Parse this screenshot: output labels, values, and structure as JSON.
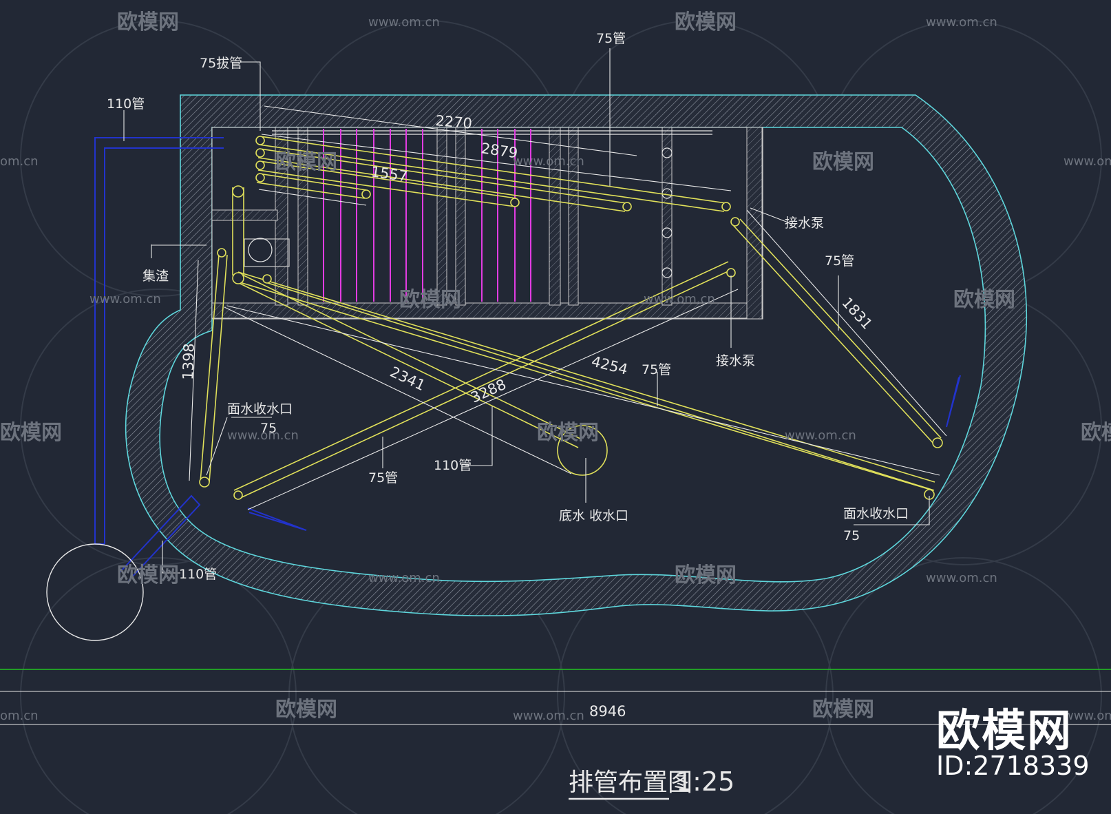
{
  "drawing": {
    "title": "排管布置图",
    "scale": "1:25"
  },
  "labels": {
    "pipe_75_pull": "75拔管",
    "pipe_110_top": "110管",
    "pipe_75_top": "75管",
    "pipe_75_right": "75管",
    "pipe_75_mid": "75管",
    "pipe_75_left": "75管",
    "pipe_110_mid": "110管",
    "pipe_110_bottom": "110管",
    "collect_slag": "集渣",
    "pump_1": "接水泵",
    "pump_2": "接水泵",
    "surface_inlet_left": "面水收水口",
    "surface_inlet_left_size": "75",
    "surface_inlet_right": "面水收水口",
    "surface_inlet_right_size": "75",
    "bottom_inlet": "底水  收水口"
  },
  "dimensions": {
    "d2270": "2270",
    "d2879": "2879",
    "d1557": "1557",
    "d1398": "1398",
    "d1831": "1831",
    "d4254": "4254",
    "d2341": "2341",
    "d3288": "3288",
    "d8946": "8946"
  },
  "watermark": {
    "brand": "欧模网",
    "url": "www.om.cn",
    "url_short": "om.cn",
    "id": "ID:2718339"
  },
  "colors": {
    "background": "#222835",
    "pool_outline": "#5ed6dc",
    "pipe_yellow": "#e0e05a",
    "pipe_magenta": "#e23ce2",
    "pipe_blue": "#2233cc",
    "line_white": "#e8e8e8",
    "line_green": "#22c422"
  }
}
